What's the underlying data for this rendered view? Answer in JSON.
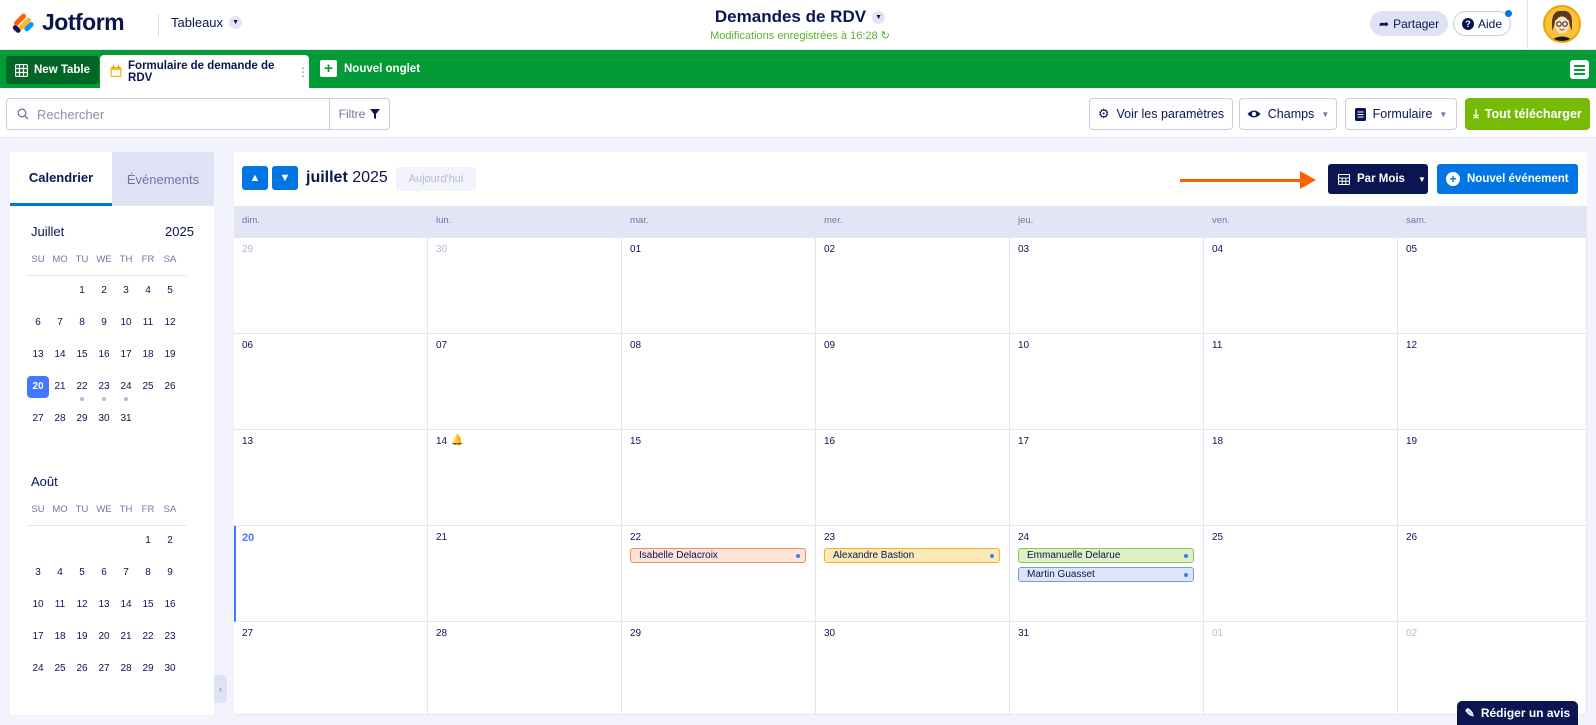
{
  "header": {
    "logo_text": "Jotform",
    "tables_label": "Tableaux",
    "title": "Demandes de RDV",
    "status": "Modifications enregistrées à 16:28",
    "share_label": "Partager",
    "help_label": "Aide"
  },
  "tabs": {
    "new_table": "New Table",
    "form_tab": "Formulaire de demande de RDV",
    "new_tab": "Nouvel onglet"
  },
  "toolbar": {
    "search_placeholder": "Rechercher",
    "filter_label": "Filtre",
    "settings_label": "Voir les paramètres",
    "fields_label": "Champs",
    "form_label": "Formulaire",
    "download_label": "Tout télécharger"
  },
  "sidebar": {
    "tab_calendar": "Calendrier",
    "tab_events": "Événements",
    "weekdays": [
      "SU",
      "MO",
      "TU",
      "WE",
      "TH",
      "FR",
      "SA"
    ],
    "months": [
      {
        "name": "Juillet",
        "year": "2025",
        "weeks": [
          [
            "",
            "",
            "1",
            "2",
            "3",
            "4",
            "5"
          ],
          [
            "6",
            "7",
            "8",
            "9",
            "10",
            "11",
            "12"
          ],
          [
            "13",
            "14",
            "15",
            "16",
            "17",
            "18",
            "19"
          ],
          [
            "20",
            "21",
            "22",
            "23",
            "24",
            "25",
            "26"
          ],
          [
            "27",
            "28",
            "29",
            "30",
            "31",
            "",
            ""
          ]
        ],
        "today": "20",
        "event_days": [
          "22",
          "23",
          "24"
        ]
      },
      {
        "name": "Août",
        "year": "",
        "weeks": [
          [
            "",
            "",
            "",
            "",
            "",
            "1",
            "2"
          ],
          [
            "3",
            "4",
            "5",
            "6",
            "7",
            "8",
            "9"
          ],
          [
            "10",
            "11",
            "12",
            "13",
            "14",
            "15",
            "16"
          ],
          [
            "17",
            "18",
            "19",
            "20",
            "21",
            "22",
            "23"
          ],
          [
            "24",
            "25",
            "26",
            "27",
            "28",
            "29",
            "30"
          ]
        ],
        "today": "",
        "event_days": []
      }
    ]
  },
  "calendar": {
    "month": "juillet",
    "year": "2025",
    "today_label": "Aujourd'hui",
    "view_label": "Par Mois",
    "new_event_label": "Nouvel événement",
    "day_headers": [
      "dim.",
      "lun.",
      "mar.",
      "mer.",
      "jeu.",
      "ven.",
      "sam."
    ],
    "weeks": [
      [
        {
          "n": "29",
          "out": true
        },
        {
          "n": "30",
          "out": true
        },
        {
          "n": "01"
        },
        {
          "n": "02"
        },
        {
          "n": "03"
        },
        {
          "n": "04"
        },
        {
          "n": "05"
        }
      ],
      [
        {
          "n": "06"
        },
        {
          "n": "07"
        },
        {
          "n": "08"
        },
        {
          "n": "09"
        },
        {
          "n": "10"
        },
        {
          "n": "11"
        },
        {
          "n": "12"
        }
      ],
      [
        {
          "n": "13"
        },
        {
          "n": "14",
          "bell": true
        },
        {
          "n": "15"
        },
        {
          "n": "16"
        },
        {
          "n": "17"
        },
        {
          "n": "18"
        },
        {
          "n": "19"
        }
      ],
      [
        {
          "n": "20",
          "today": true
        },
        {
          "n": "21"
        },
        {
          "n": "22"
        },
        {
          "n": "23"
        },
        {
          "n": "24"
        },
        {
          "n": "25"
        },
        {
          "n": "26"
        }
      ],
      [
        {
          "n": "27"
        },
        {
          "n": "28"
        },
        {
          "n": "29"
        },
        {
          "n": "30"
        },
        {
          "n": "31"
        },
        {
          "n": "01",
          "out": true
        },
        {
          "n": "02",
          "out": true
        }
      ]
    ],
    "events": [
      {
        "week": 3,
        "day": 2,
        "slot": 0,
        "name": "Isabelle Delacroix",
        "bg": "#fde3d8",
        "border": "#f08a5d"
      },
      {
        "week": 3,
        "day": 3,
        "slot": 0,
        "name": "Alexandre Bastion",
        "bg": "#fde9b5",
        "border": "#f0b429"
      },
      {
        "week": 3,
        "day": 4,
        "slot": 0,
        "name": "Emmanuelle Delarue",
        "bg": "#def0c6",
        "border": "#8cc850"
      },
      {
        "week": 3,
        "day": 4,
        "slot": 1,
        "name": "Martin Guasset",
        "bg": "#dde6f6",
        "border": "#7b9bd6"
      }
    ]
  },
  "feedback_label": "Rédiger un avis",
  "colors": {
    "brand_green": "#029b37",
    "primary_blue": "#0075e3",
    "navy": "#0a1551",
    "download_green": "#78bb07",
    "annotation_arrow": "#ff6100"
  }
}
